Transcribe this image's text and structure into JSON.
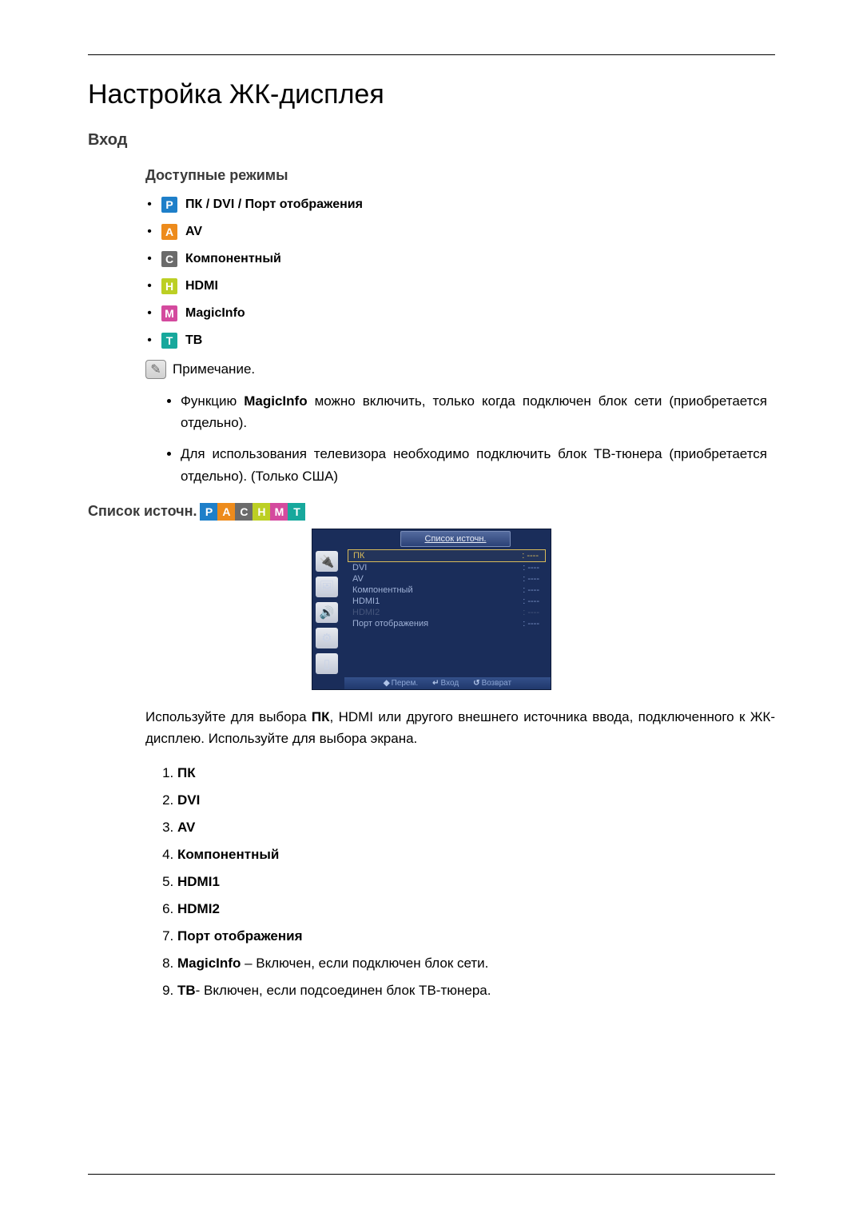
{
  "title": "Настройка ЖК-дисплея",
  "h_input": "Вход",
  "h_modes": "Доступные режимы",
  "modes": [
    {
      "k": "P",
      "cls": "p",
      "label": "ПК / DVI / Порт отображения"
    },
    {
      "k": "A",
      "cls": "a",
      "label": "AV"
    },
    {
      "k": "C",
      "cls": "c",
      "label": "Компонентный"
    },
    {
      "k": "H",
      "cls": "h",
      "label": "HDMI"
    },
    {
      "k": "M",
      "cls": "m",
      "label": "MagicInfo"
    },
    {
      "k": "T",
      "cls": "t",
      "label": "ТВ"
    }
  ],
  "note_label": "Примечание.",
  "notes": [
    {
      "pre": "Функцию ",
      "b": "MagicInfo",
      "post": " можно включить, только когда подключен блок сети (приобретается отдельно)."
    },
    {
      "pre": "",
      "b": "",
      "post": "Для использования телевизора необходимо подключить блок ТВ-тюнера (приобретается отдельно). (Только США)"
    }
  ],
  "src_heading": "Список источн.",
  "src_badges": [
    "P",
    "A",
    "C",
    "H",
    "M",
    "T"
  ],
  "osd": {
    "title": "Список источн.",
    "rows": [
      {
        "n": "ПК",
        "v": ": ----",
        "sel": true
      },
      {
        "n": "DVI",
        "v": ": ----"
      },
      {
        "n": "AV",
        "v": ": ----"
      },
      {
        "n": "Компонентный",
        "v": ": ----"
      },
      {
        "n": "HDMI1",
        "v": ": ----"
      },
      {
        "n": "HDMI2",
        "v": ": ----",
        "dim": true
      },
      {
        "n": "Порт отображения",
        "v": ": ----"
      }
    ],
    "foot": [
      "Перем.",
      "Вход",
      "Возврат"
    ]
  },
  "para": "Используйте для выбора ПК, HDMI или другого внешнего источника ввода, подключенного к ЖК-дисплею. Используйте для выбора экрана.",
  "para_bold": "ПК",
  "list": [
    {
      "b": "ПК",
      "t": ""
    },
    {
      "b": "DVI",
      "t": ""
    },
    {
      "b": "AV",
      "t": ""
    },
    {
      "b": "Компонентный",
      "t": ""
    },
    {
      "b": "HDMI1",
      "t": ""
    },
    {
      "b": "HDMI2",
      "t": ""
    },
    {
      "b": "Порт отображения",
      "t": ""
    },
    {
      "b": "MagicInfo",
      "t": " – Включен, если подключен блок сети."
    },
    {
      "b": "ТВ",
      "t": "- Включен, если подсоединен блок ТВ-тюнера."
    }
  ]
}
